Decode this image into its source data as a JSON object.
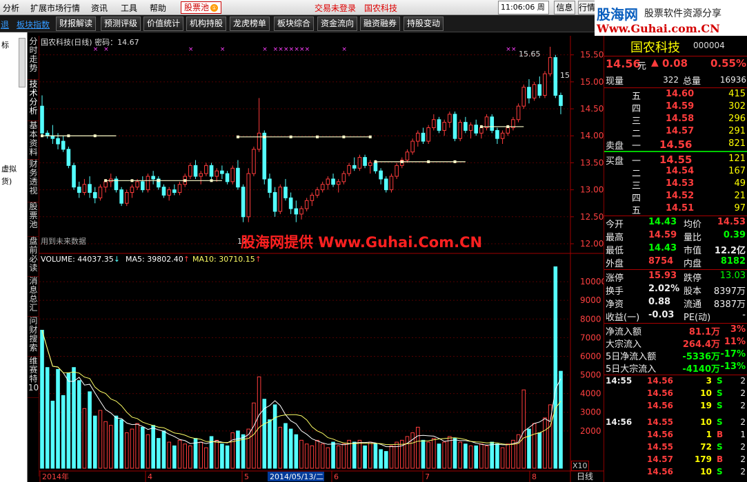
{
  "menu": {
    "items": [
      "分析",
      "扩展市场行情",
      "资讯",
      "工具",
      "帮助"
    ],
    "pool_label": "股票池",
    "pool_badge": "①",
    "status": "交易未登录",
    "stock_title": "国农科技",
    "time": "11:06:06",
    "weekday": "周日",
    "info_label": "信息",
    "hq_label": "行情"
  },
  "toolbar": {
    "first_link": "板块指数",
    "buttons": [
      "财报解读",
      "预测评级",
      "价值统计",
      "机构持股",
      "龙虎榜单",
      "板块综合",
      "资金流向",
      "融资融券",
      "持股变动"
    ]
  },
  "brand": {
    "name": "股海网",
    "slogan": "股票软件资源分享",
    "url": "Www.Guhai.com.CN"
  },
  "left_strip": {
    "top_label": "标",
    "mid_label1": "虚拟",
    "mid_label2": "货)"
  },
  "vtabs": [
    "分时走势",
    "技术分析",
    "基本资料",
    "财务透视",
    "股票池",
    "盘前必读",
    "消息总汇",
    "问财搜索",
    "维赛特10"
  ],
  "chart": {
    "title": "国农科技(日线) 密码：14.67",
    "watermark": "股海网提供 Www.Guhai.Com.CN",
    "future_note": "用到未来数据",
    "high_label": "15.65",
    "high_side_label": "15",
    "low_label": "12",
    "volume_info": "VOLUME: 44037.35",
    "ma5_info": "MA5: 39802.40",
    "ma10_info": "MA10: 30710.15",
    "x10_label": "X10",
    "period_label": "日线",
    "date_labels": [
      "2014年",
      "4",
      "5",
      "6",
      "7",
      "8"
    ],
    "selected_date": "2014/05/13/二",
    "price_axis": [
      "15.50",
      "15.00",
      "14.50",
      "14.00",
      "13.50",
      "13.00",
      "12.50",
      "12.00"
    ],
    "volume_axis": [
      "10000",
      "9000",
      "8000",
      "7000",
      "6000",
      "5000",
      "4000",
      "3000",
      "2000"
    ],
    "colors": {
      "up": "#ff3c3c",
      "down": "#54ffff",
      "ma5": "#ffffff",
      "ma10": "#ffff66",
      "axis": "#a00000"
    }
  },
  "chart_data": {
    "type": "candlestick",
    "title": "国农科技(日线)",
    "ylim": [
      12.0,
      15.7
    ],
    "y_ticks": [
      12.0,
      12.5,
      13.0,
      13.5,
      14.0,
      14.5,
      15.0,
      15.5
    ],
    "volume_ylim": [
      0,
      11000
    ],
    "volume_ticks": [
      2000,
      3000,
      4000,
      5000,
      6000,
      7000,
      8000,
      9000,
      10000
    ],
    "x_labels": [
      "2014年",
      "4",
      "5",
      "6",
      "7",
      "8"
    ],
    "candles": [
      [
        14.55,
        14.75,
        14.0,
        14.05
      ],
      [
        14.05,
        14.1,
        13.95,
        14.0
      ],
      [
        14.0,
        14.2,
        13.85,
        13.95
      ],
      [
        13.95,
        14.05,
        13.75,
        13.85
      ],
      [
        13.9,
        14.0,
        13.7,
        13.75
      ],
      [
        13.75,
        13.8,
        13.4,
        13.45
      ],
      [
        13.45,
        13.5,
        13.0,
        13.05
      ],
      [
        13.05,
        13.15,
        12.85,
        12.95
      ],
      [
        12.95,
        13.2,
        12.9,
        13.1
      ],
      [
        13.1,
        13.25,
        12.85,
        12.95
      ],
      [
        12.95,
        13.05,
        12.75,
        12.85
      ],
      [
        12.85,
        13.1,
        12.8,
        13.05
      ],
      [
        13.05,
        13.2,
        12.95,
        13.15
      ],
      [
        13.15,
        13.3,
        13.05,
        13.2
      ],
      [
        13.2,
        13.25,
        12.95,
        13.0
      ],
      [
        13.0,
        13.05,
        12.7,
        12.75
      ],
      [
        12.75,
        13.0,
        12.7,
        12.95
      ],
      [
        12.95,
        13.1,
        12.85,
        13.05
      ],
      [
        13.05,
        13.2,
        13.0,
        13.15
      ],
      [
        13.15,
        13.25,
        12.95,
        13.0
      ],
      [
        13.0,
        13.3,
        12.95,
        13.25
      ],
      [
        13.25,
        13.35,
        13.1,
        13.2
      ],
      [
        13.2,
        13.25,
        13.0,
        13.05
      ],
      [
        13.05,
        13.1,
        12.85,
        12.9
      ],
      [
        12.9,
        13.05,
        12.8,
        13.0
      ],
      [
        13.0,
        13.1,
        12.9,
        12.95
      ],
      [
        12.95,
        13.15,
        12.9,
        13.1
      ],
      [
        13.1,
        13.3,
        13.05,
        13.25
      ],
      [
        13.25,
        13.5,
        13.2,
        13.45
      ],
      [
        13.45,
        13.55,
        13.2,
        13.25
      ],
      [
        13.25,
        13.35,
        13.1,
        13.3
      ],
      [
        13.3,
        13.5,
        13.25,
        13.45
      ],
      [
        13.45,
        13.5,
        13.2,
        13.25
      ],
      [
        13.25,
        13.4,
        13.15,
        13.35
      ],
      [
        13.35,
        13.45,
        13.2,
        13.3
      ],
      [
        13.3,
        13.35,
        13.1,
        13.15
      ],
      [
        13.15,
        13.45,
        13.1,
        13.4
      ],
      [
        13.4,
        13.55,
        13.0,
        13.05
      ],
      [
        13.05,
        13.1,
        12.4,
        12.5
      ],
      [
        12.5,
        13.4,
        12.4,
        13.3
      ],
      [
        13.3,
        13.8,
        13.25,
        13.75
      ],
      [
        13.75,
        14.7,
        13.7,
        14.05
      ],
      [
        14.05,
        14.1,
        13.1,
        13.2
      ],
      [
        13.2,
        13.3,
        12.85,
        12.95
      ],
      [
        12.95,
        13.05,
        12.5,
        12.6
      ],
      [
        12.6,
        13.1,
        12.55,
        13.05
      ],
      [
        13.05,
        13.2,
        12.8,
        12.85
      ],
      [
        12.85,
        12.95,
        12.55,
        12.65
      ],
      [
        12.65,
        12.8,
        12.4,
        12.55
      ],
      [
        12.55,
        12.7,
        12.45,
        12.65
      ],
      [
        12.65,
        12.85,
        12.6,
        12.8
      ],
      [
        12.8,
        12.95,
        12.7,
        12.9
      ],
      [
        12.9,
        13.05,
        12.85,
        13.0
      ],
      [
        13.0,
        13.15,
        12.95,
        13.1
      ],
      [
        13.1,
        13.25,
        13.0,
        13.2
      ],
      [
        13.2,
        13.3,
        13.05,
        13.1
      ],
      [
        13.1,
        13.2,
        12.95,
        13.15
      ],
      [
        13.15,
        13.35,
        13.1,
        13.3
      ],
      [
        13.3,
        13.5,
        13.25,
        13.45
      ],
      [
        13.45,
        13.6,
        13.35,
        13.4
      ],
      [
        13.4,
        13.65,
        13.35,
        13.6
      ],
      [
        13.6,
        13.65,
        13.4,
        13.45
      ],
      [
        13.45,
        13.55,
        13.3,
        13.5
      ],
      [
        13.5,
        13.55,
        13.3,
        13.35
      ],
      [
        13.35,
        13.4,
        13.1,
        13.2
      ],
      [
        13.2,
        13.25,
        12.95,
        13.0
      ],
      [
        13.0,
        13.3,
        12.95,
        13.25
      ],
      [
        13.25,
        13.5,
        13.2,
        13.45
      ],
      [
        13.45,
        13.6,
        13.4,
        13.55
      ],
      [
        13.55,
        13.75,
        13.5,
        13.7
      ],
      [
        13.7,
        13.95,
        13.65,
        13.9
      ],
      [
        13.9,
        14.1,
        13.8,
        14.05
      ],
      [
        14.05,
        14.15,
        13.85,
        13.9
      ],
      [
        13.9,
        14.2,
        13.85,
        14.15
      ],
      [
        14.15,
        14.4,
        14.1,
        14.3
      ],
      [
        14.3,
        14.35,
        14.05,
        14.1
      ],
      [
        14.1,
        14.3,
        14.0,
        14.25
      ],
      [
        14.25,
        14.45,
        14.15,
        14.4
      ],
      [
        14.4,
        14.45,
        13.9,
        13.95
      ],
      [
        13.95,
        14.3,
        13.9,
        14.25
      ],
      [
        14.25,
        14.35,
        14.05,
        14.1
      ],
      [
        14.1,
        14.25,
        13.95,
        14.2
      ],
      [
        14.2,
        14.3,
        14.0,
        14.05
      ],
      [
        14.05,
        14.2,
        13.95,
        14.15
      ],
      [
        14.15,
        14.4,
        14.1,
        14.35
      ],
      [
        14.35,
        14.4,
        14.05,
        14.1
      ],
      [
        14.1,
        14.15,
        13.85,
        13.95
      ],
      [
        13.95,
        14.1,
        13.85,
        14.05
      ],
      [
        14.05,
        14.2,
        14.0,
        14.15
      ],
      [
        14.15,
        14.35,
        14.1,
        14.3
      ],
      [
        14.3,
        14.6,
        14.25,
        14.55
      ],
      [
        14.55,
        14.95,
        14.5,
        14.9
      ],
      [
        14.9,
        15.05,
        14.6,
        14.7
      ],
      [
        14.7,
        15.0,
        14.65,
        14.95
      ],
      [
        14.95,
        15.1,
        14.7,
        14.75
      ],
      [
        14.75,
        15.2,
        14.7,
        15.15
      ],
      [
        15.15,
        15.65,
        15.1,
        15.45
      ],
      [
        15.45,
        15.5,
        14.7,
        14.75
      ],
      [
        14.75,
        14.8,
        14.4,
        14.56
      ]
    ],
    "volumes": [
      7400,
      5400,
      3600,
      5300,
      3900,
      5100,
      5400,
      4700,
      3200,
      4100,
      2800,
      3100,
      2500,
      2300,
      2800,
      2600,
      1900,
      2100,
      2400,
      2200,
      1800,
      2300,
      1600,
      2000,
      1400,
      1200,
      1500,
      1300,
      1200,
      1600,
      1400,
      1100,
      1700,
      1500,
      1300,
      1200,
      1900,
      2000,
      1800,
      2100,
      3500,
      4900,
      3700,
      2600,
      3400,
      2200,
      2400,
      2100,
      1800,
      1500,
      1300,
      1200,
      1500,
      1300,
      1100,
      1400,
      1200,
      1300,
      1500,
      1400,
      1500,
      1200,
      1400,
      1300,
      1000,
      900,
      1200,
      1400,
      1500,
      1700,
      1900,
      2200,
      1500,
      1400,
      1600,
      1300,
      1400,
      1700,
      1600,
      1400,
      1300,
      1200,
      1200,
      1300,
      1200,
      1400,
      1300,
      1100,
      1300,
      1500,
      1800,
      4200,
      2100,
      2400,
      1900,
      2700,
      3400,
      10800,
      5200
    ],
    "levels": [
      14.0,
      13.17,
      13.98,
      13.52,
      14.17
    ]
  },
  "quote": {
    "name": "国农科技",
    "code": "000004",
    "price": "14.56",
    "price_unit": "元",
    "change_arrow": "▲",
    "change": "0.08",
    "change_pct": "0.55%",
    "now_vol_label": "现量",
    "now_vol": "322",
    "total_vol_label": "总量",
    "total_vol": "16936",
    "sell_label": "卖盘",
    "buy_label": "买盘",
    "sell": [
      {
        "level": "五",
        "price": "14.60",
        "vol": "415"
      },
      {
        "level": "四",
        "price": "14.59",
        "vol": "302"
      },
      {
        "level": "三",
        "price": "14.58",
        "vol": "296"
      },
      {
        "level": "二",
        "price": "14.57",
        "vol": "291"
      },
      {
        "level": "一",
        "price": "14.56",
        "vol": "821"
      }
    ],
    "buy": [
      {
        "level": "一",
        "price": "14.55",
        "vol": "121"
      },
      {
        "level": "二",
        "price": "14.54",
        "vol": "167"
      },
      {
        "level": "三",
        "price": "14.53",
        "vol": "49"
      },
      {
        "level": "四",
        "price": "14.52",
        "vol": "21"
      },
      {
        "level": "五",
        "price": "14.51",
        "vol": "97"
      }
    ],
    "stats": [
      {
        "l1": "今开",
        "v1": "14.43",
        "c1": "green",
        "l2": "均价",
        "v2": "14.53",
        "c2": "red"
      },
      {
        "l1": "最高",
        "v1": "14.59",
        "c1": "red",
        "l2": "量比",
        "v2": "0.39",
        "c2": "green"
      },
      {
        "l1": "最低",
        "v1": "14.43",
        "c1": "green",
        "l2": "市值",
        "v2": "12.2亿",
        "c2": "white"
      },
      {
        "l1": "外盘",
        "v1": "8754",
        "c1": "red",
        "l2": "内盘",
        "v2": "8182",
        "c2": "green"
      }
    ],
    "stats2": [
      {
        "l1": "涨停",
        "v1": "15.93",
        "c1": "red",
        "l2": "跌停",
        "v2": "13.03",
        "c2": "green"
      },
      {
        "l1": "换手",
        "v1": "2.02%",
        "c1": "white",
        "l2": "股本",
        "v2": "8397万",
        "c2": "white"
      },
      {
        "l1": "净资",
        "v1": "0.88",
        "c1": "white",
        "l2": "流通",
        "v2": "8387万",
        "c2": "white"
      },
      {
        "l1": "收益(一)",
        "v1": "-0.03",
        "c1": "white",
        "l2": "PE(动)",
        "v2": "-",
        "c2": "white"
      }
    ],
    "flows": [
      {
        "label": "净流入额",
        "value": "81.1万",
        "pct": "3%",
        "color": "red"
      },
      {
        "label": "大宗流入",
        "value": "264.4万",
        "pct": "11%",
        "color": "red"
      },
      {
        "label": "5日净流入额",
        "value": "-5336万",
        "pct": "-17%",
        "color": "green"
      },
      {
        "label": "5日大宗流入",
        "value": "-4140万",
        "pct": "-13%",
        "color": "green"
      }
    ],
    "ticks": [
      {
        "time": "14:55",
        "price": "14.56",
        "vol": "3",
        "side": "S",
        "num": "2"
      },
      {
        "time": "",
        "price": "14.56",
        "vol": "10",
        "side": "S",
        "num": "2"
      },
      {
        "time": "",
        "price": "14.56",
        "vol": "19",
        "side": "S",
        "num": "2"
      },
      {
        "time": "14:56",
        "price": "14.55",
        "vol": "10",
        "side": "S",
        "num": "2"
      },
      {
        "time": "",
        "price": "14.56",
        "vol": "1",
        "side": "B",
        "num": "1"
      },
      {
        "time": "",
        "price": "14.55",
        "vol": "72",
        "side": "S",
        "num": "2"
      },
      {
        "time": "",
        "price": "14.57",
        "vol": "179",
        "side": "B",
        "num": "2"
      },
      {
        "time": "",
        "price": "14.56",
        "vol": "10",
        "side": "S",
        "num": "2"
      },
      {
        "time": "15:00",
        "price": "14.56",
        "vol": "322",
        "side": "",
        "num": ""
      }
    ]
  }
}
